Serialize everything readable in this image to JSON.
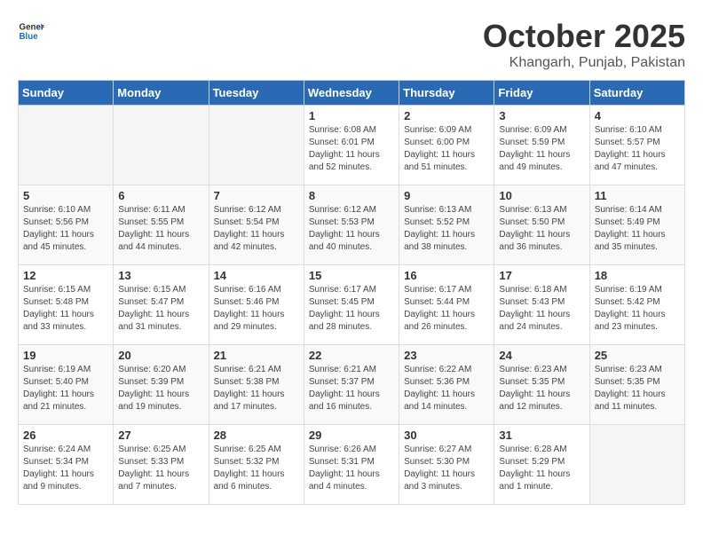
{
  "header": {
    "logo_general": "General",
    "logo_blue": "Blue",
    "month": "October 2025",
    "location": "Khangarh, Punjab, Pakistan"
  },
  "weekdays": [
    "Sunday",
    "Monday",
    "Tuesday",
    "Wednesday",
    "Thursday",
    "Friday",
    "Saturday"
  ],
  "weeks": [
    [
      {
        "day": "",
        "info": ""
      },
      {
        "day": "",
        "info": ""
      },
      {
        "day": "",
        "info": ""
      },
      {
        "day": "1",
        "info": "Sunrise: 6:08 AM\nSunset: 6:01 PM\nDaylight: 11 hours\nand 52 minutes."
      },
      {
        "day": "2",
        "info": "Sunrise: 6:09 AM\nSunset: 6:00 PM\nDaylight: 11 hours\nand 51 minutes."
      },
      {
        "day": "3",
        "info": "Sunrise: 6:09 AM\nSunset: 5:59 PM\nDaylight: 11 hours\nand 49 minutes."
      },
      {
        "day": "4",
        "info": "Sunrise: 6:10 AM\nSunset: 5:57 PM\nDaylight: 11 hours\nand 47 minutes."
      }
    ],
    [
      {
        "day": "5",
        "info": "Sunrise: 6:10 AM\nSunset: 5:56 PM\nDaylight: 11 hours\nand 45 minutes."
      },
      {
        "day": "6",
        "info": "Sunrise: 6:11 AM\nSunset: 5:55 PM\nDaylight: 11 hours\nand 44 minutes."
      },
      {
        "day": "7",
        "info": "Sunrise: 6:12 AM\nSunset: 5:54 PM\nDaylight: 11 hours\nand 42 minutes."
      },
      {
        "day": "8",
        "info": "Sunrise: 6:12 AM\nSunset: 5:53 PM\nDaylight: 11 hours\nand 40 minutes."
      },
      {
        "day": "9",
        "info": "Sunrise: 6:13 AM\nSunset: 5:52 PM\nDaylight: 11 hours\nand 38 minutes."
      },
      {
        "day": "10",
        "info": "Sunrise: 6:13 AM\nSunset: 5:50 PM\nDaylight: 11 hours\nand 36 minutes."
      },
      {
        "day": "11",
        "info": "Sunrise: 6:14 AM\nSunset: 5:49 PM\nDaylight: 11 hours\nand 35 minutes."
      }
    ],
    [
      {
        "day": "12",
        "info": "Sunrise: 6:15 AM\nSunset: 5:48 PM\nDaylight: 11 hours\nand 33 minutes."
      },
      {
        "day": "13",
        "info": "Sunrise: 6:15 AM\nSunset: 5:47 PM\nDaylight: 11 hours\nand 31 minutes."
      },
      {
        "day": "14",
        "info": "Sunrise: 6:16 AM\nSunset: 5:46 PM\nDaylight: 11 hours\nand 29 minutes."
      },
      {
        "day": "15",
        "info": "Sunrise: 6:17 AM\nSunset: 5:45 PM\nDaylight: 11 hours\nand 28 minutes."
      },
      {
        "day": "16",
        "info": "Sunrise: 6:17 AM\nSunset: 5:44 PM\nDaylight: 11 hours\nand 26 minutes."
      },
      {
        "day": "17",
        "info": "Sunrise: 6:18 AM\nSunset: 5:43 PM\nDaylight: 11 hours\nand 24 minutes."
      },
      {
        "day": "18",
        "info": "Sunrise: 6:19 AM\nSunset: 5:42 PM\nDaylight: 11 hours\nand 23 minutes."
      }
    ],
    [
      {
        "day": "19",
        "info": "Sunrise: 6:19 AM\nSunset: 5:40 PM\nDaylight: 11 hours\nand 21 minutes."
      },
      {
        "day": "20",
        "info": "Sunrise: 6:20 AM\nSunset: 5:39 PM\nDaylight: 11 hours\nand 19 minutes."
      },
      {
        "day": "21",
        "info": "Sunrise: 6:21 AM\nSunset: 5:38 PM\nDaylight: 11 hours\nand 17 minutes."
      },
      {
        "day": "22",
        "info": "Sunrise: 6:21 AM\nSunset: 5:37 PM\nDaylight: 11 hours\nand 16 minutes."
      },
      {
        "day": "23",
        "info": "Sunrise: 6:22 AM\nSunset: 5:36 PM\nDaylight: 11 hours\nand 14 minutes."
      },
      {
        "day": "24",
        "info": "Sunrise: 6:23 AM\nSunset: 5:35 PM\nDaylight: 11 hours\nand 12 minutes."
      },
      {
        "day": "25",
        "info": "Sunrise: 6:23 AM\nSunset: 5:35 PM\nDaylight: 11 hours\nand 11 minutes."
      }
    ],
    [
      {
        "day": "26",
        "info": "Sunrise: 6:24 AM\nSunset: 5:34 PM\nDaylight: 11 hours\nand 9 minutes."
      },
      {
        "day": "27",
        "info": "Sunrise: 6:25 AM\nSunset: 5:33 PM\nDaylight: 11 hours\nand 7 minutes."
      },
      {
        "day": "28",
        "info": "Sunrise: 6:25 AM\nSunset: 5:32 PM\nDaylight: 11 hours\nand 6 minutes."
      },
      {
        "day": "29",
        "info": "Sunrise: 6:26 AM\nSunset: 5:31 PM\nDaylight: 11 hours\nand 4 minutes."
      },
      {
        "day": "30",
        "info": "Sunrise: 6:27 AM\nSunset: 5:30 PM\nDaylight: 11 hours\nand 3 minutes."
      },
      {
        "day": "31",
        "info": "Sunrise: 6:28 AM\nSunset: 5:29 PM\nDaylight: 11 hours\nand 1 minute."
      },
      {
        "day": "",
        "info": ""
      }
    ]
  ]
}
